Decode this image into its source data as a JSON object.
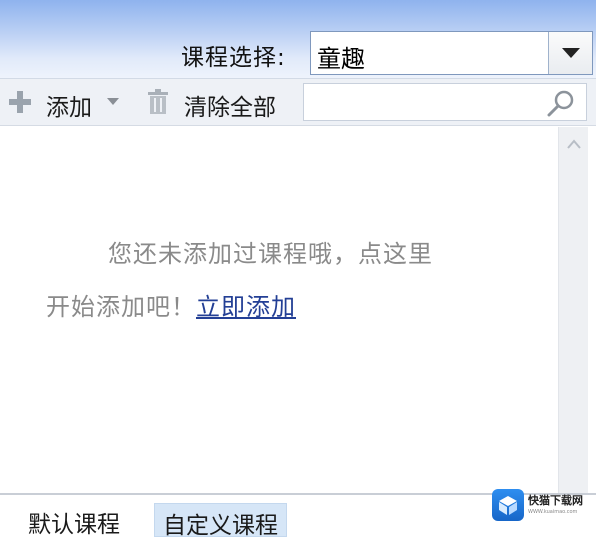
{
  "header": {
    "course_label": "课程选择:",
    "course_value": "童趣"
  },
  "toolbar": {
    "add_label": "添加",
    "clear_label": "清除全部",
    "search_placeholder": ""
  },
  "empty_state": {
    "line1": "您还未添加过课程哦，点这里",
    "line2_prefix": "开始添加吧！",
    "link_label": "立即添加"
  },
  "tabs": [
    {
      "label": "默认课程",
      "active": false
    },
    {
      "label": "自定义课程",
      "active": true
    }
  ],
  "watermark": {
    "title": "快猫下载网",
    "subtitle": "WWW.kuaimao.com"
  },
  "colors": {
    "header_top": "#8fb3ee",
    "link": "#233f95",
    "active_tab": "#d6e6f7"
  },
  "icons": {
    "add": "plus-icon",
    "caret": "caret-down-icon",
    "clear": "trash-icon",
    "search": "search-icon",
    "dropdown": "dropdown-arrow-icon",
    "scroll": "scroll-up-icon"
  }
}
